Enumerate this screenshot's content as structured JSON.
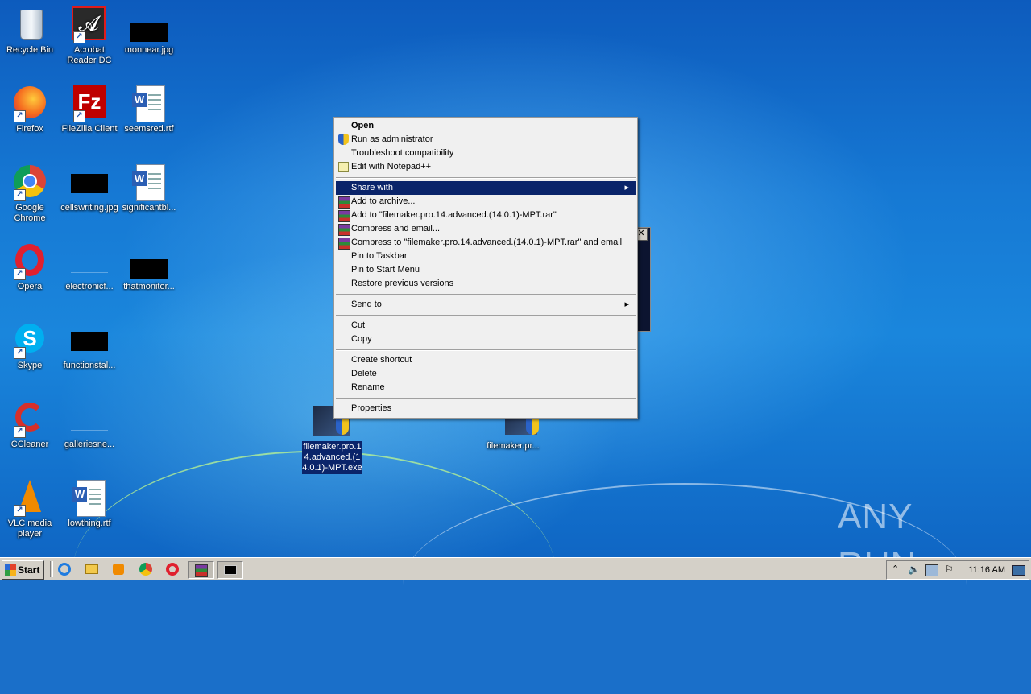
{
  "desktop": {
    "icons": [
      {
        "label": "Recycle Bin"
      },
      {
        "label": "Acrobat Reader DC"
      },
      {
        "label": "monnear.jpg"
      },
      {
        "label": "Firefox"
      },
      {
        "label": "FileZilla Client"
      },
      {
        "label": "seemsred.rtf"
      },
      {
        "label": "Google Chrome"
      },
      {
        "label": "cellswriting.jpg"
      },
      {
        "label": "significantbl..."
      },
      {
        "label": "Opera"
      },
      {
        "label": "electronicf..."
      },
      {
        "label": "thatmonitor..."
      },
      {
        "label": "Skype"
      },
      {
        "label": "functionstal..."
      },
      {
        "label": "CCleaner"
      },
      {
        "label": "galleriesne..."
      },
      {
        "label": "VLC media player"
      },
      {
        "label": "lowthing.rtf"
      },
      {
        "label": "filemaker.pro.14.advanced.(14.0.1)-MPT.exe"
      },
      {
        "label": "filemaker.pr..."
      }
    ]
  },
  "context_menu": {
    "items": [
      {
        "label": "Open"
      },
      {
        "label": "Run as administrator"
      },
      {
        "label": "Troubleshoot compatibility"
      },
      {
        "label": "Edit with Notepad++"
      },
      {
        "label": "Share with"
      },
      {
        "label": "Add to archive..."
      },
      {
        "label": "Add to \"filemaker.pro.14.advanced.(14.0.1)-MPT.rar\""
      },
      {
        "label": "Compress and email..."
      },
      {
        "label": "Compress to \"filemaker.pro.14.advanced.(14.0.1)-MPT.rar\" and email"
      },
      {
        "label": "Pin to Taskbar"
      },
      {
        "label": "Pin to Start Menu"
      },
      {
        "label": "Restore previous versions"
      },
      {
        "label": "Send to"
      },
      {
        "label": "Cut"
      },
      {
        "label": "Copy"
      },
      {
        "label": "Create shortcut"
      },
      {
        "label": "Delete"
      },
      {
        "label": "Rename"
      },
      {
        "label": "Properties"
      }
    ]
  },
  "taskbar": {
    "start_label": "Start",
    "clock": "11:16 AM"
  },
  "watermark": "ANY RUN"
}
